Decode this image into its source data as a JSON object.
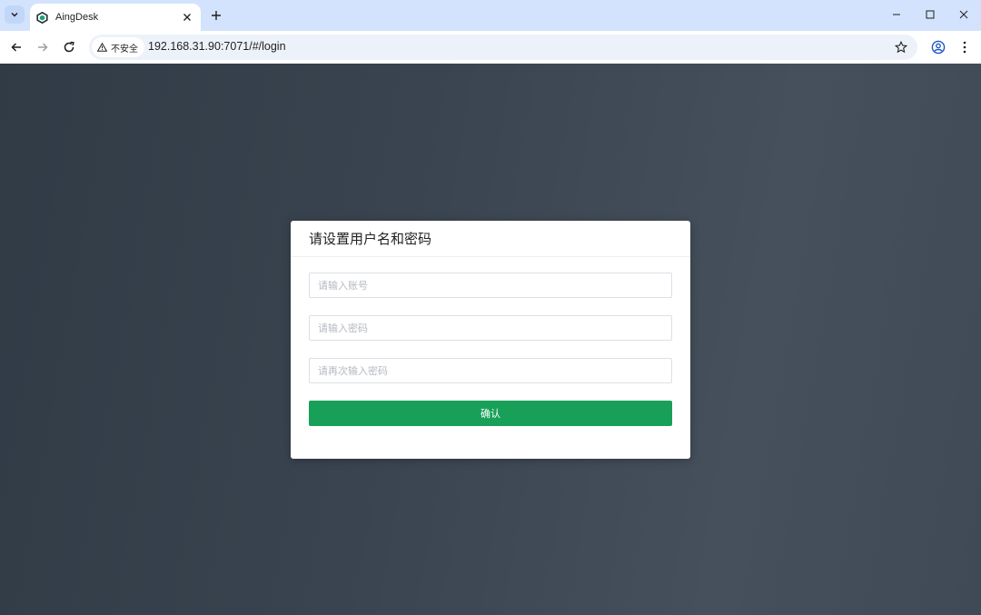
{
  "browser": {
    "tab_title": "AingDesk",
    "security_label": "不安全",
    "url": "192.168.31.90:7071/#/login",
    "icons": {
      "tab_search": "chevron-down-icon",
      "favicon": "aingdesk-favicon-icon",
      "tab_close": "close-icon",
      "new_tab": "plus-icon",
      "back": "arrow-left-icon",
      "forward": "arrow-right-icon",
      "reload": "reload-icon",
      "warning": "warning-triangle-icon",
      "bookmark": "star-icon",
      "profile": "profile-icon",
      "menu": "more-vert-icon",
      "minimize": "minimize-icon",
      "maximize": "maximize-icon",
      "close_window": "close-window-icon"
    }
  },
  "login": {
    "title": "请设置用户名和密码",
    "username_placeholder": "请输入账号",
    "username_value": "",
    "password_placeholder": "请输入密码",
    "password_value": "",
    "confirm_password_placeholder": "请再次输入密码",
    "confirm_password_value": "",
    "confirm_button": "确认"
  },
  "colors": {
    "primary": "#18a058",
    "tab_strip": "#d3e3fd",
    "background": "#3a4450"
  }
}
